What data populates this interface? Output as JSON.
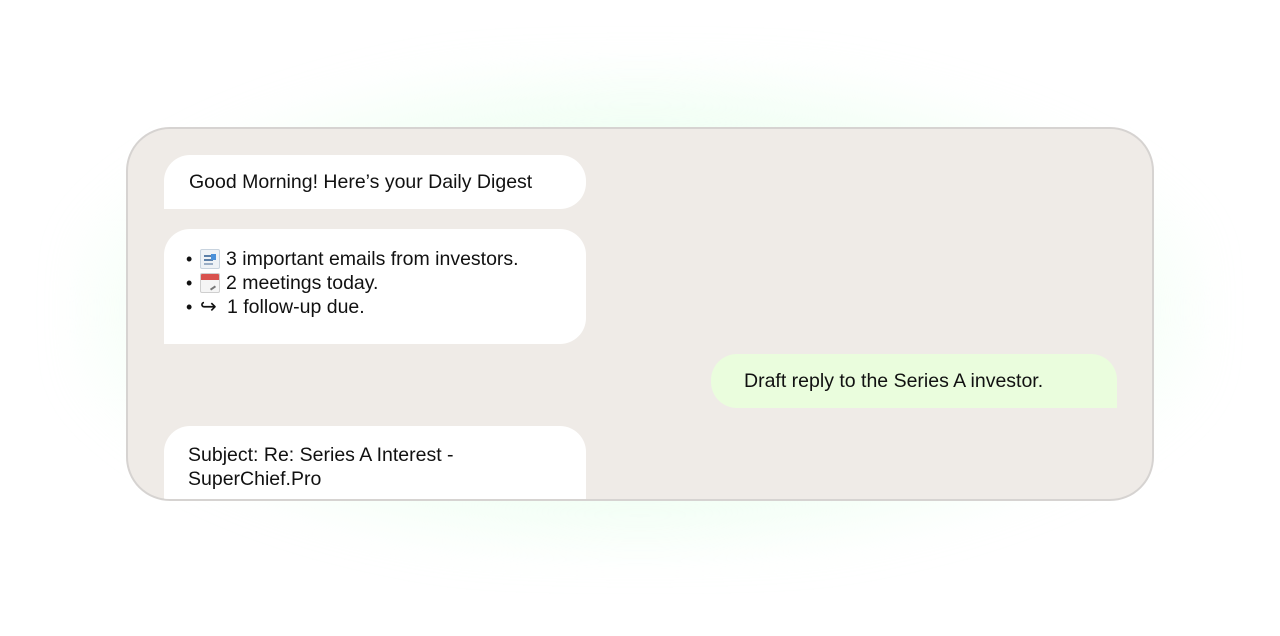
{
  "chat": {
    "greeting": "Good Morning! Here’s your Daily Digest",
    "digest_items": [
      {
        "icon": "newspaper-icon",
        "text": "3 important emails from investors."
      },
      {
        "icon": "calendar-icon",
        "text": "2 meetings today."
      },
      {
        "icon": "return-arrow-icon",
        "glyph": "↪",
        "text": "1 follow-up due."
      }
    ],
    "user_message": "Draft reply to the Series A investor.",
    "draft_subject_line1": "Subject: Re: Series A Interest -",
    "draft_subject_line2": "SuperChief.Pro"
  },
  "colors": {
    "chat_background": "#efebe7",
    "bot_bubble": "#ffffff",
    "user_bubble": "#eafddd",
    "glow": "#c8ffd2"
  }
}
